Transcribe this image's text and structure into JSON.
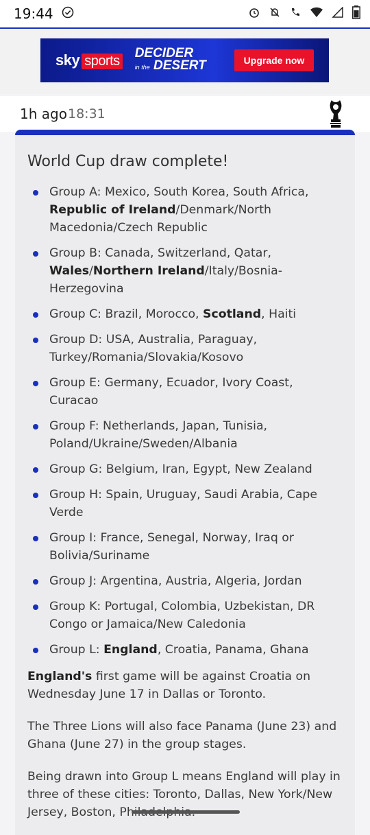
{
  "status": {
    "time": "19:44"
  },
  "ad": {
    "brand_sky": "sky",
    "brand_sports": "sports",
    "headline_line1": "DECIDER",
    "headline_small": "in the",
    "headline_line2": "DESERT",
    "cta": "Upgrade now"
  },
  "post": {
    "relative_time": "1h ago",
    "clock_time": "18:31"
  },
  "article": {
    "title": "World Cup draw complete!",
    "groups": [
      {
        "pre": "Group A: Mexico, South Korea, South Africa, ",
        "bold": "Republic of Ireland",
        "post": "/Denmark/North Macedonia/Czech Republic"
      },
      {
        "pre": "Group B: Canada, Switzerland, Qatar, ",
        "bold": "Wales",
        "mid": "/",
        "bold2": "Northern Ireland",
        "post": "/Italy/Bosnia-Herzegovina"
      },
      {
        "pre": "Group C: Brazil, Morocco, ",
        "bold": "Scotland",
        "post": ", Haiti"
      },
      {
        "pre": "Group D: USA, Australia, Paraguay, Turkey/Romania/Slovakia/Kosovo"
      },
      {
        "pre": "Group E: Germany, Ecuador, Ivory Coast, Curacao"
      },
      {
        "pre": "Group F: Netherlands, Japan, Tunisia, Poland/Ukraine/Sweden/Albania"
      },
      {
        "pre": "Group G: Belgium, Iran, Egypt, New Zealand"
      },
      {
        "pre": "Group H: Spain, Uruguay, Saudi Arabia, Cape Verde"
      },
      {
        "pre": "Group I: France, Senegal, Norway, Iraq or Bolivia/Suriname"
      },
      {
        "pre": "Group J: Argentina, Austria, Algeria, Jordan"
      },
      {
        "pre": "Group K: Portugal, Colombia, Uzbekistan, DR Congo or Jamaica/New Caledonia"
      },
      {
        "pre": "Group L: ",
        "bold": "England",
        "post": ", Croatia, Panama, Ghana"
      }
    ],
    "para1_bold": "England's",
    "para1_rest": " first game will be against Croatia on Wednesday June 17 in Dallas or Toronto.",
    "para2": "The Three Lions will also face Panama (June 23) and Ghana (June 27) in the group stages.",
    "para3": "Being drawn into Group L means England will play in three of these cities: Toronto, Dallas, New York/New Jersey, Boston, Philadelphia."
  },
  "colors": {
    "accent": "#1b2fbf",
    "ad_red": "#e8132b",
    "card_bg": "#ececee"
  }
}
